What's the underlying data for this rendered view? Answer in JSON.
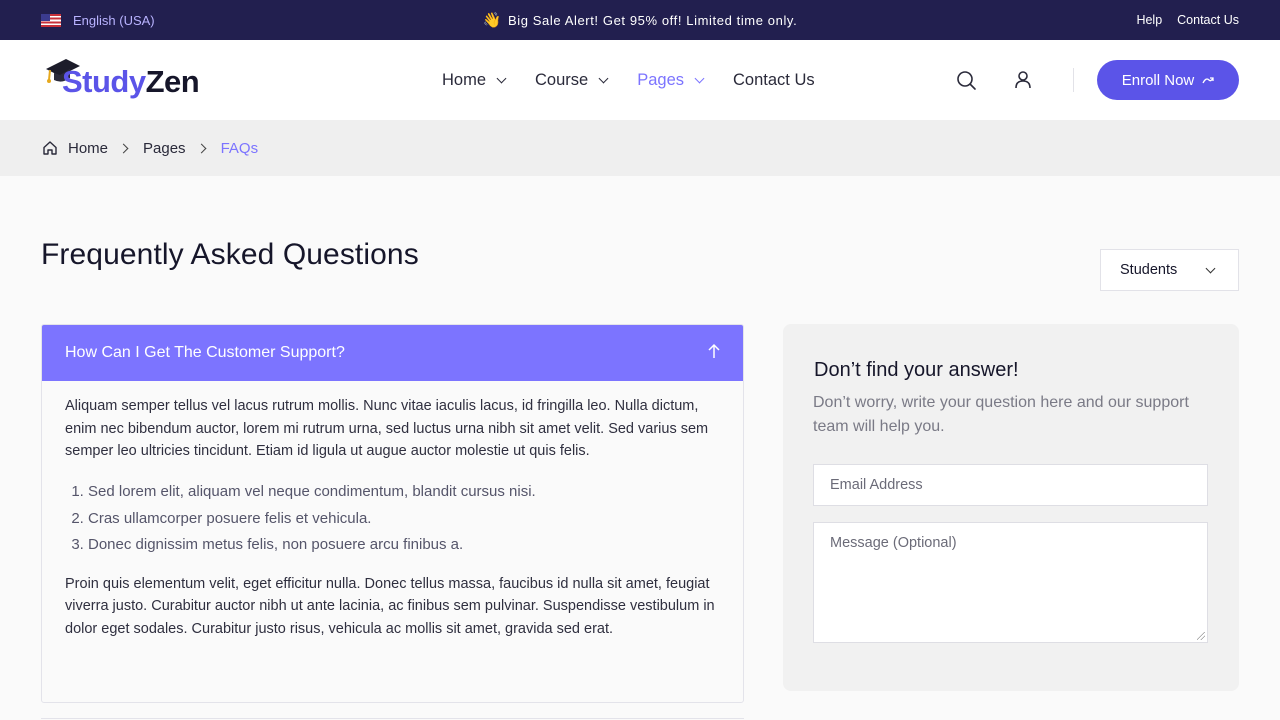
{
  "topbar": {
    "language": "English (USA)",
    "promo_icon": "👋",
    "promo": "Big Sale Alert! Get 95% off! Limited time only.",
    "links": [
      "Help",
      "Contact Us"
    ]
  },
  "header": {
    "logo_part1": "Study",
    "logo_part2": "Zen",
    "nav": [
      {
        "label": "Home"
      },
      {
        "label": "Course"
      },
      {
        "label": "Pages"
      },
      {
        "label": "Contact Us"
      }
    ],
    "enroll_label": "Enroll Now"
  },
  "breadcrumb": {
    "items": [
      "Home",
      "Pages",
      "FAQs"
    ]
  },
  "main": {
    "title": "Frequently Asked Questions",
    "filter_selected": "Students",
    "faq": {
      "question": "How Can I Get The Customer Support?",
      "paragraph1": "Aliquam semper tellus vel lacus rutrum mollis. Nunc vitae iaculis lacus, id fringilla leo. Nulla dictum, enim nec bibendum auctor, lorem mi rutrum urna, sed luctus urna nibh sit amet velit. Sed varius sem semper leo ultricies tincidunt. Etiam id ligula ut augue auctor molestie ut quis felis.",
      "list": [
        "Sed lorem elit, aliquam vel neque condimentum, blandit cursus nisi.",
        "Cras ullamcorper posuere felis et vehicula.",
        "Donec dignissim metus felis, non posuere arcu finibus a."
      ],
      "paragraph2": "Proin quis elementum velit, eget efficitur nulla. Donec tellus massa, faucibus id nulla sit amet, feugiat viverra justo. Curabitur auctor nibh ut ante lacinia, ac finibus sem pulvinar. Suspendisse vestibulum in dolor eget sodales. Curabitur justo risus, vehicula ac mollis sit amet, gravida sed erat."
    },
    "contact": {
      "heading": "Don’t find your answer!",
      "subtext": "Don’t worry, write your question here and our support team will help you.",
      "email_placeholder": "Email Address",
      "message_placeholder": "Message (Optional)"
    }
  },
  "colors": {
    "topbar_bg": "#221f4f",
    "brand": "#5b54e8",
    "accent": "#7c74ff"
  },
  "icons": [
    "flag-us-icon",
    "waving-hand-icon",
    "graduation-cap-icon",
    "chevron-down-icon",
    "search-icon",
    "user-icon",
    "arrow-up-right-icon",
    "home-icon",
    "chevron-right-icon",
    "arrow-up-icon"
  ]
}
